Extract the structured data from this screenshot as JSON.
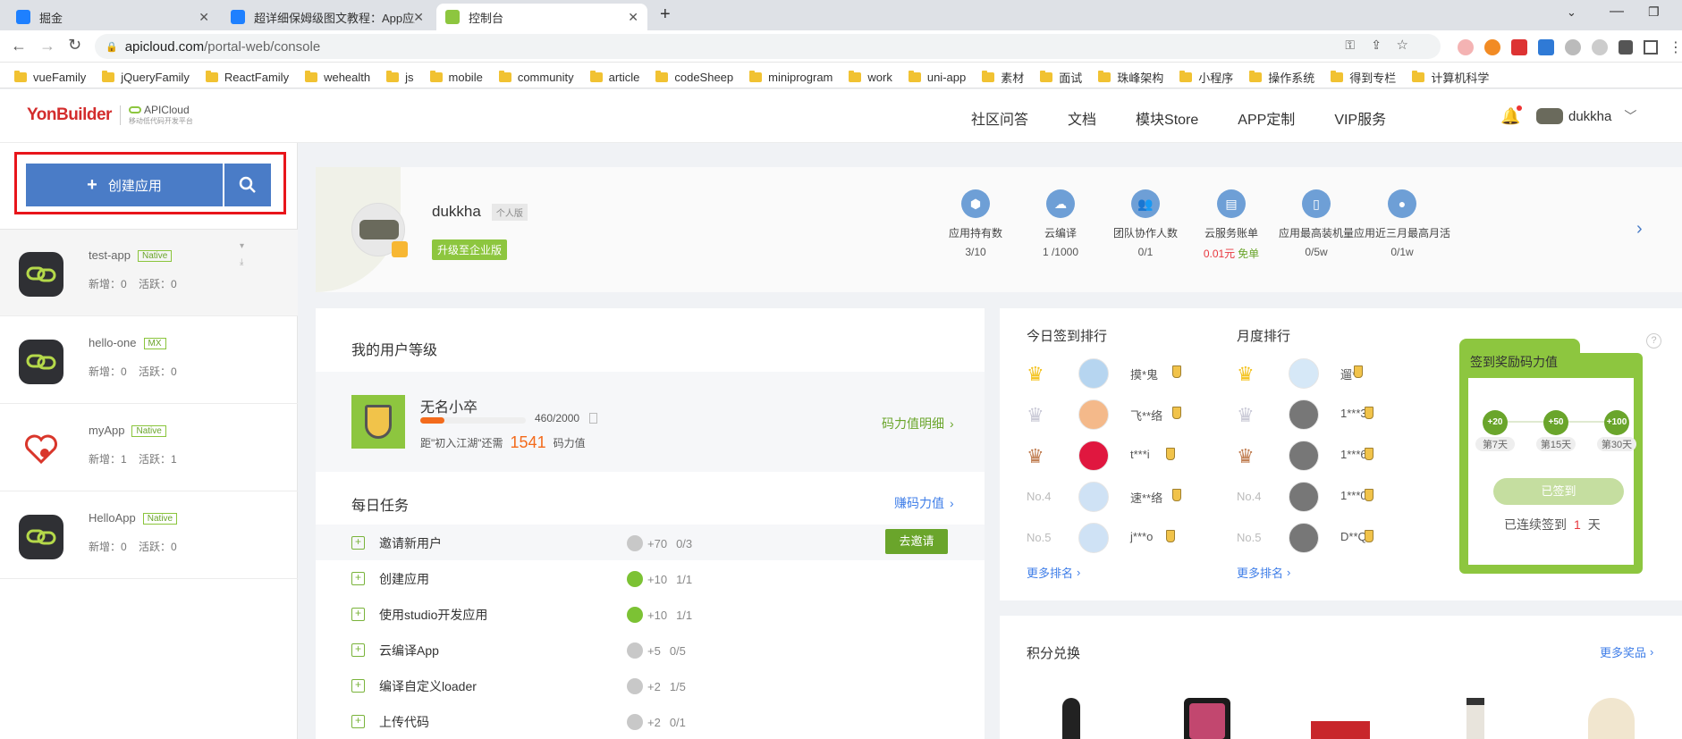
{
  "browser": {
    "tabs": [
      {
        "title": "掘金"
      },
      {
        "title": "超详细保姆级图文教程：App应用"
      },
      {
        "title": "控制台"
      }
    ],
    "url_domain": "apicloud.com",
    "url_path": "/portal-web/console",
    "bookmarks": [
      "vueFamily",
      "jQueryFamily",
      "ReactFamily",
      "wehealth",
      "js",
      "mobile",
      "community",
      "article",
      "codeSheep",
      "miniprogram",
      "work",
      "uni-app",
      "素材",
      "面试",
      "珠峰架构",
      "小程序",
      "操作系统",
      "得到专栏",
      "计算机科学"
    ]
  },
  "header": {
    "logo_main": "YonBuilder",
    "logo_sub": "APICloud",
    "logo_tagline": "移动低代码开发平台",
    "nav": [
      "社区问答",
      "文档",
      "模块Store",
      "APP定制",
      "VIP服务"
    ],
    "username": "dukkha"
  },
  "sidebar": {
    "create_label": "创建应用",
    "apps": [
      {
        "name": "test-app",
        "tag": "Native",
        "stats": "新增：0    活跃：0"
      },
      {
        "name": "hello-one",
        "tag": "MX",
        "stats": "新增：0    活跃：0"
      },
      {
        "name": "myApp",
        "tag": "Native",
        "stats": "新增：1    活跃：1"
      },
      {
        "name": "HelloApp",
        "tag": "Native",
        "stats": "新增：0    活跃：0"
      }
    ]
  },
  "profile": {
    "name": "dukkha",
    "edition": "个人版",
    "upgrade": "升级至企业版",
    "stats": [
      {
        "icon": "cube-icon",
        "label": "应用持有数",
        "value": "3/10"
      },
      {
        "icon": "cloud-icon",
        "label": "云编译",
        "value": "1 /1000"
      },
      {
        "icon": "team-icon",
        "label": "团队协作人数",
        "value": "0/1"
      },
      {
        "icon": "bill-icon",
        "label": "云服务账单",
        "value_red": "0.01元",
        "value_green": "免单"
      },
      {
        "icon": "phone-icon",
        "label": "应用最高装机量",
        "value": "0/5w"
      },
      {
        "icon": "user-icon",
        "label": "应用近三月最高月活",
        "value": "0/1w"
      }
    ]
  },
  "level": {
    "title": "我的用户等级",
    "level_name": "无名小卒",
    "progress_text": "460/2000",
    "progress": 0.23,
    "hint_pre": "距\"初入江湖\"还需",
    "hint_num": "1541",
    "hint_post": "码力值",
    "detail_link": "码力值明细"
  },
  "tasks": {
    "title": "每日任务",
    "earn_link": "赚码力值",
    "items": [
      {
        "name": "邀请新用户",
        "reward": "+70",
        "progress": "0/3",
        "done": false,
        "action": "去邀请"
      },
      {
        "name": "创建应用",
        "reward": "+10",
        "progress": "1/1",
        "done": true
      },
      {
        "name": "使用studio开发应用",
        "reward": "+10",
        "progress": "1/1",
        "done": true
      },
      {
        "name": "云编译App",
        "reward": "+5",
        "progress": "0/5",
        "done": false
      },
      {
        "name": "编译自定义loader",
        "reward": "+2",
        "progress": "1/5",
        "done": false
      },
      {
        "name": "上传代码",
        "reward": "+2",
        "progress": "0/1",
        "done": false
      }
    ]
  },
  "ranking": {
    "today_title": "今日签到排行",
    "month_title": "月度排行",
    "more": "更多排名",
    "today": [
      {
        "rank": "1",
        "user": "摸*鬼"
      },
      {
        "rank": "2",
        "user": "飞**络"
      },
      {
        "rank": "3",
        "user": "t***i"
      },
      {
        "rank": "No.4",
        "user": "速**络"
      },
      {
        "rank": "No.5",
        "user": "j***o"
      }
    ],
    "month": [
      {
        "rank": "1",
        "user": "遛*"
      },
      {
        "rank": "2",
        "user": "1***3"
      },
      {
        "rank": "3",
        "user": "1***6"
      },
      {
        "rank": "No.4",
        "user": "1***0"
      },
      {
        "rank": "No.5",
        "user": "D**Q"
      }
    ]
  },
  "checkin": {
    "title": "签到奖励码力值",
    "rewards": [
      {
        "amount": "+20",
        "day": "第7天"
      },
      {
        "amount": "+50",
        "day": "第15天"
      },
      {
        "amount": "+100",
        "day": "第30天"
      }
    ],
    "button": "已签到",
    "streak_pre": "已连续签到",
    "streak_num": "1",
    "streak_post": "天"
  },
  "exchange": {
    "title": "积分兑换",
    "more": "更多奖品"
  },
  "colors": {
    "accent": "#4a7cc7",
    "green": "#8dc63f",
    "orange": "#f36b1c",
    "red": "#e8373e"
  }
}
